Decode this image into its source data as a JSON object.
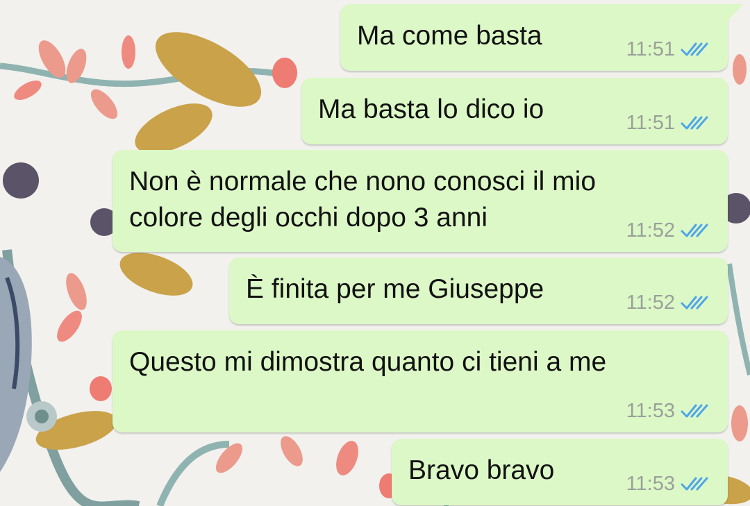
{
  "colors": {
    "bubble_outgoing": "#dcf8c6",
    "read_tick": "#4fa5e8",
    "time_text": "#9aa09a"
  },
  "messages": [
    {
      "text": "Ma come basta",
      "time": "11:51",
      "status": "read-double-tick-icon"
    },
    {
      "text": "Ma basta lo dico io",
      "time": "11:51",
      "status": "read-double-tick-icon"
    },
    {
      "text": "Non è normale che nono conosci il mio\ncolore degli occhi dopo 3 anni",
      "time": "11:52",
      "status": "read-double-tick-icon"
    },
    {
      "text": "È finita per me Giuseppe",
      "time": "11:52",
      "status": "read-double-tick-icon"
    },
    {
      "text": "Questo mi dimostra quanto ci tieni a me",
      "time": "11:53",
      "status": "read-double-tick-icon"
    },
    {
      "text": "Bravo bravo",
      "time": "11:53",
      "status": "read-double-tick-icon"
    }
  ]
}
